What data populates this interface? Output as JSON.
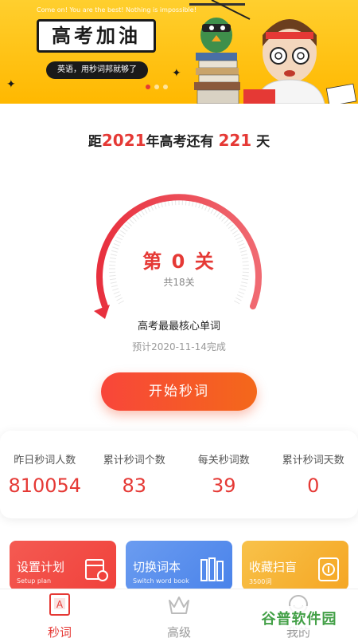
{
  "banner": {
    "subtitle": "Come on! You are the best! Nothing is impossible!",
    "title": "高考加油",
    "slogan": "英语，用秒词邦就够了"
  },
  "countdown": {
    "prefix": "距",
    "year": "2021",
    "middle": "年高考还有 ",
    "days": "221",
    "suffix": " 天"
  },
  "progress": {
    "level": "第 0 关",
    "total": "共18关",
    "book": "高考最最核心单词",
    "expect": "预计2020-11-14完成",
    "fraction": 0
  },
  "start_button": "开始秒词",
  "stats": [
    {
      "label": "昨日秒词人数",
      "value": "810054"
    },
    {
      "label": "累计秒词个数",
      "value": "83"
    },
    {
      "label": "每关秒词数",
      "value": "39"
    },
    {
      "label": "累计秒词天数",
      "value": "0"
    }
  ],
  "cards": [
    {
      "title": "设置计划",
      "sub": "Setup plan",
      "icon": "calendar-icon"
    },
    {
      "title": "切换词本",
      "sub": "Switch word book",
      "icon": "books-icon"
    },
    {
      "title": "收藏扫盲",
      "sub": "3500词",
      "icon": "archive-icon"
    }
  ],
  "tabs": [
    {
      "label": "秒词",
      "icon": "word-card-icon",
      "active": true
    },
    {
      "label": "高级",
      "icon": "crown-icon",
      "active": false
    },
    {
      "label": "我的",
      "icon": "profile-icon",
      "active": false
    }
  ],
  "watermark": "谷普软件园",
  "colors": {
    "accent": "#e53935",
    "banner": "#ffb800",
    "button_start": "#f8463a",
    "button_end": "#f4681a"
  }
}
